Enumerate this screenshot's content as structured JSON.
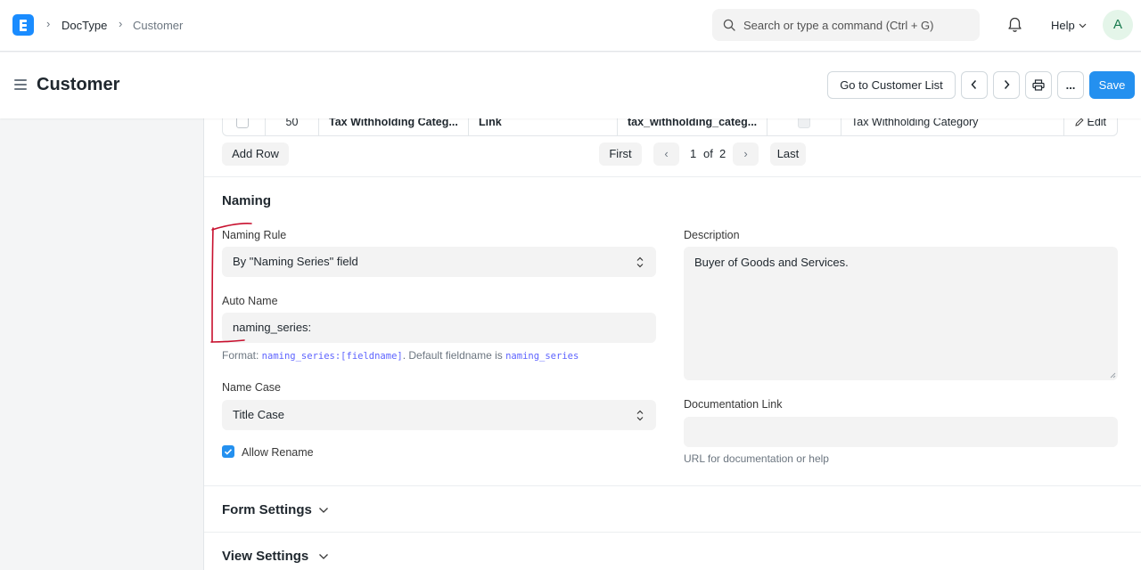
{
  "navbar": {
    "breadcrumbs": [
      "DocType",
      "Customer"
    ],
    "search_placeholder": "Search or type a command (Ctrl + G)",
    "help_label": "Help",
    "avatar_initial": "A"
  },
  "header": {
    "title": "Customer",
    "go_to_list_label": "Go to Customer List",
    "save_label": "Save",
    "more_label": "..."
  },
  "fields_table": {
    "row": {
      "index": "50",
      "label": "Tax Withholding Categ...",
      "type": "Link",
      "name": "tax_withholding_categ...",
      "options": "Tax Withholding Category",
      "edit_label": "Edit"
    },
    "add_row_label": "Add Row",
    "pagination": {
      "first_label": "First",
      "prev_label": "‹",
      "current_page": "1",
      "of_label": "of",
      "total_pages": "2",
      "next_label": "›",
      "last_label": "Last"
    }
  },
  "naming": {
    "section_title": "Naming",
    "naming_rule": {
      "label": "Naming Rule",
      "value": "By \"Naming Series\" field"
    },
    "auto_name": {
      "label": "Auto Name",
      "value": "naming_series:"
    },
    "format_hint": {
      "prefix": "Format: ",
      "format_code": "naming_series:[fieldname]",
      "middle": ". Default fieldname is ",
      "default_code": "naming_series"
    },
    "name_case": {
      "label": "Name Case",
      "value": "Title Case"
    },
    "allow_rename": {
      "label": "Allow Rename",
      "checked": true
    },
    "description": {
      "label": "Description",
      "value": "Buyer of Goods and Services."
    },
    "documentation_link": {
      "label": "Documentation Link",
      "value": "",
      "hint": "URL for documentation or help"
    }
  },
  "sections": {
    "form_settings": "Form Settings",
    "view_settings": "View Settings"
  },
  "colors": {
    "primary": "#2490ef",
    "logo": "#1a8cff",
    "annotation": "#c8102e",
    "code": "#5e64ff"
  }
}
